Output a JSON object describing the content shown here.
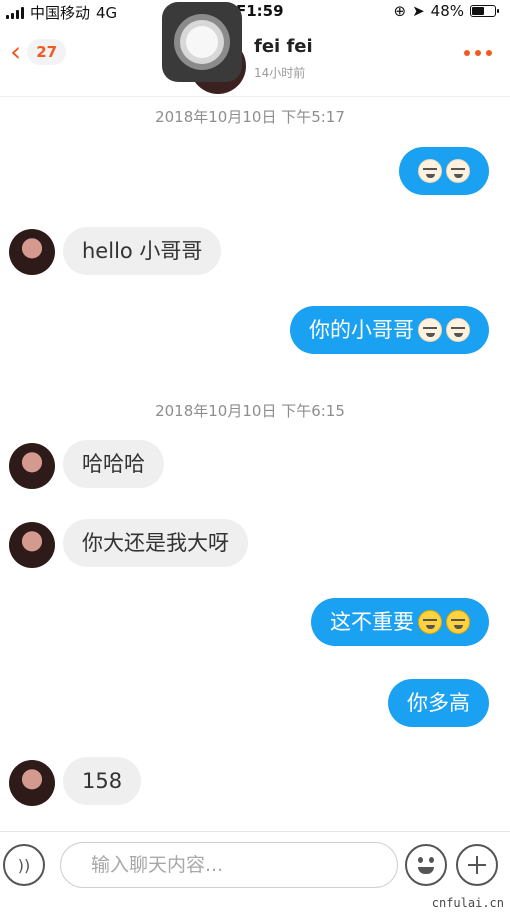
{
  "status_bar": {
    "carrier": "中国移动",
    "network": "4G",
    "time": "下午1:59",
    "time_visible": "F1:59",
    "battery_percent": "48%",
    "battery_level": 0.48
  },
  "header": {
    "back_count": "27",
    "peer_name": "fei fei",
    "peer_status": "14小时前"
  },
  "messages": [
    {
      "type": "timestamp",
      "text": "2018年10月10日 下午5:17"
    },
    {
      "type": "out",
      "text": "",
      "emojis": [
        "grimace-emoji",
        "grimace-emoji"
      ]
    },
    {
      "type": "in",
      "text": "hello 小哥哥"
    },
    {
      "type": "out",
      "text": "你的小哥哥",
      "emojis": [
        "grimace-emoji",
        "grimace-emoji"
      ]
    },
    {
      "type": "timestamp",
      "text": "2018年10月10日 下午6:15"
    },
    {
      "type": "in",
      "text": "哈哈哈"
    },
    {
      "type": "in",
      "text": "你大还是我大呀"
    },
    {
      "type": "out",
      "text": "这不重要",
      "emojis": [
        "laugh-tears-emoji",
        "laugh-tears-emoji"
      ]
    },
    {
      "type": "out",
      "text": "你多高"
    },
    {
      "type": "in",
      "text": "158"
    }
  ],
  "input": {
    "placeholder": "输入聊天内容..."
  },
  "watermark": "cnfulai.cn",
  "colors": {
    "accent": "#f05a22",
    "outgoing_bubble": "#1ba1f2",
    "incoming_bubble": "#efefef"
  }
}
